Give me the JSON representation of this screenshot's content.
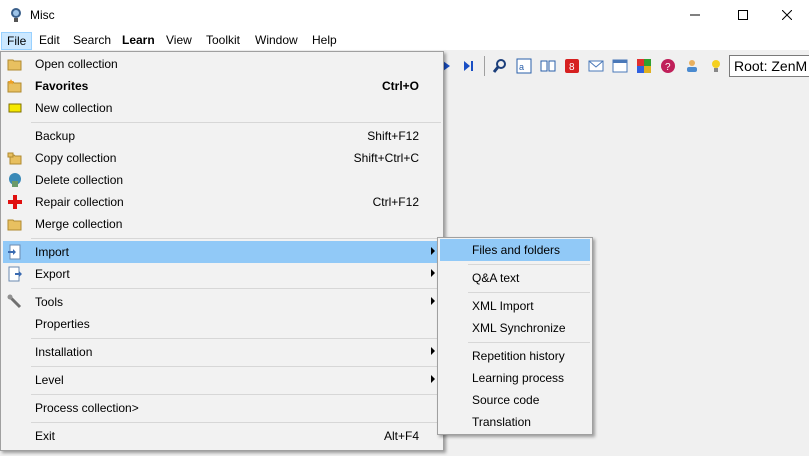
{
  "window": {
    "title": "Misc",
    "icon": "supermemo-app-icon"
  },
  "menubar": {
    "items": [
      {
        "label": "File",
        "active": true
      },
      {
        "label": "Edit"
      },
      {
        "label": "Search"
      },
      {
        "label": "Learn",
        "bold": true
      },
      {
        "label": "View"
      },
      {
        "label": "Toolkit"
      },
      {
        "label": "Window"
      },
      {
        "label": "Help"
      }
    ]
  },
  "toolbar": {
    "root_label": "Root: ZenM",
    "icons": [
      "play-icon",
      "last-icon",
      "search-icon",
      "translate-icon",
      "book-icon",
      "number-icon",
      "mail-icon",
      "calendar-icon",
      "grid-icon",
      "help-icon",
      "user-icon",
      "lightbulb-icon"
    ]
  },
  "file_menu": {
    "items": [
      {
        "label": "Open collection",
        "shortcut": "",
        "icon": "folder-open-icon"
      },
      {
        "label": "Favorites",
        "shortcut": "Ctrl+O",
        "icon": "folder-star-icon",
        "bold": true
      },
      {
        "label": "New collection",
        "shortcut": "",
        "icon": "new-collection-icon"
      },
      {
        "label": "Backup",
        "shortcut": "Shift+F12",
        "icon": ""
      },
      {
        "label": "Copy collection",
        "shortcut": "Shift+Ctrl+C",
        "icon": "copy-folder-icon"
      },
      {
        "label": "Delete collection",
        "shortcut": "",
        "icon": "recycle-bin-icon"
      },
      {
        "label": "Repair collection",
        "shortcut": "Ctrl+F12",
        "icon": "red-cross-icon"
      },
      {
        "label": "Merge collection",
        "shortcut": "",
        "icon": "merge-folder-icon"
      },
      {
        "label": "Import",
        "shortcut": "",
        "icon": "import-icon",
        "submenu": true,
        "highlighted": true
      },
      {
        "label": "Export",
        "shortcut": "",
        "icon": "export-icon",
        "submenu": true
      },
      {
        "label": "Tools",
        "shortcut": "",
        "icon": "wrench-icon",
        "submenu": true
      },
      {
        "label": "Properties",
        "shortcut": "",
        "icon": ""
      },
      {
        "label": "Installation",
        "shortcut": "",
        "icon": "",
        "submenu": true
      },
      {
        "label": "Level",
        "shortcut": "",
        "icon": "",
        "submenu": true
      },
      {
        "label": "Process collection>",
        "shortcut": "",
        "icon": ""
      },
      {
        "label": "Exit",
        "shortcut": "Alt+F4",
        "icon": ""
      }
    ]
  },
  "import_submenu": {
    "items": [
      {
        "label": "Files and folders",
        "highlighted": true
      },
      {
        "label": "Q&A text"
      },
      {
        "label": "XML Import"
      },
      {
        "label": "XML Synchronize"
      },
      {
        "label": "Repetition history"
      },
      {
        "label": "Learning process"
      },
      {
        "label": "Source code"
      },
      {
        "label": "Translation"
      }
    ]
  },
  "colors": {
    "highlight": "#91c9f7",
    "menu_active": "#cce8ff",
    "menu_bg": "#f2f2f2"
  }
}
